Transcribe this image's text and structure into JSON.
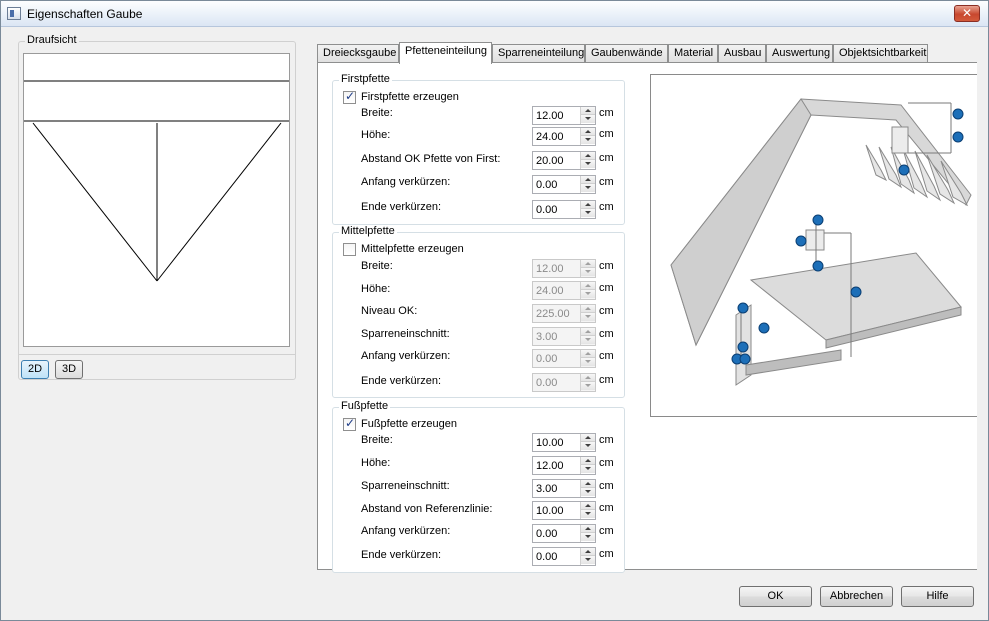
{
  "window": {
    "title": "Eigenschaften Gaube",
    "close_label": "✕"
  },
  "left": {
    "group_title": "Draufsicht",
    "view_buttons": [
      {
        "label": "2D",
        "active": true
      },
      {
        "label": "3D",
        "active": false
      }
    ]
  },
  "tabs": [
    {
      "label": "Dreiecksgaube",
      "active": false
    },
    {
      "label": "Pfetteneinteilung",
      "active": true
    },
    {
      "label": "Sparreneinteilung",
      "active": false
    },
    {
      "label": "Gaubenwände",
      "active": false
    },
    {
      "label": "Material",
      "active": false
    },
    {
      "label": "Ausbau",
      "active": false
    },
    {
      "label": "Auswertung",
      "active": false
    },
    {
      "label": "Objektsichtbarkeit",
      "active": false
    }
  ],
  "firstpfette": {
    "title": "Firstpfette",
    "checkbox_label": "Firstpfette erzeugen",
    "checked": true,
    "fields": [
      {
        "label": "Breite:",
        "value": "12.00",
        "unit": "cm"
      },
      {
        "label": "Höhe:",
        "value": "24.00",
        "unit": "cm"
      },
      {
        "label": "Abstand OK Pfette von First:",
        "value": "20.00",
        "unit": "cm"
      },
      {
        "label": "Anfang verkürzen:",
        "value": "0.00",
        "unit": "cm"
      },
      {
        "label": "Ende verkürzen:",
        "value": "0.00",
        "unit": "cm"
      }
    ]
  },
  "mittelpfette": {
    "title": "Mittelpfette",
    "checkbox_label": "Mittelpfette erzeugen",
    "checked": false,
    "fields": [
      {
        "label": "Breite:",
        "value": "12.00",
        "unit": "cm"
      },
      {
        "label": "Höhe:",
        "value": "24.00",
        "unit": "cm"
      },
      {
        "label": "Niveau OK:",
        "value": "225.00",
        "unit": "cm"
      },
      {
        "label": "Sparreneinschnitt:",
        "value": "3.00",
        "unit": "cm"
      },
      {
        "label": "Anfang verkürzen:",
        "value": "0.00",
        "unit": "cm"
      },
      {
        "label": "Ende verkürzen:",
        "value": "0.00",
        "unit": "cm"
      }
    ]
  },
  "fusspfette": {
    "title": "Fußpfette",
    "checkbox_label": "Fußpfette erzeugen",
    "checked": true,
    "fields": [
      {
        "label": "Breite:",
        "value": "10.00",
        "unit": "cm"
      },
      {
        "label": "Höhe:",
        "value": "12.00",
        "unit": "cm"
      },
      {
        "label": "Sparreneinschnitt:",
        "value": "3.00",
        "unit": "cm"
      },
      {
        "label": "Abstand von Referenzlinie:",
        "value": "10.00",
        "unit": "cm"
      },
      {
        "label": "Anfang verkürzen:",
        "value": "0.00",
        "unit": "cm"
      },
      {
        "label": "Ende verkürzen:",
        "value": "0.00",
        "unit": "cm"
      }
    ]
  },
  "buttons": {
    "ok": "OK",
    "cancel": "Abbrechen",
    "help": "Hilfe"
  },
  "colors": {
    "handle": "#1d6fb8",
    "roof": "#d6d6d6",
    "accent": "#3c7fb1"
  }
}
